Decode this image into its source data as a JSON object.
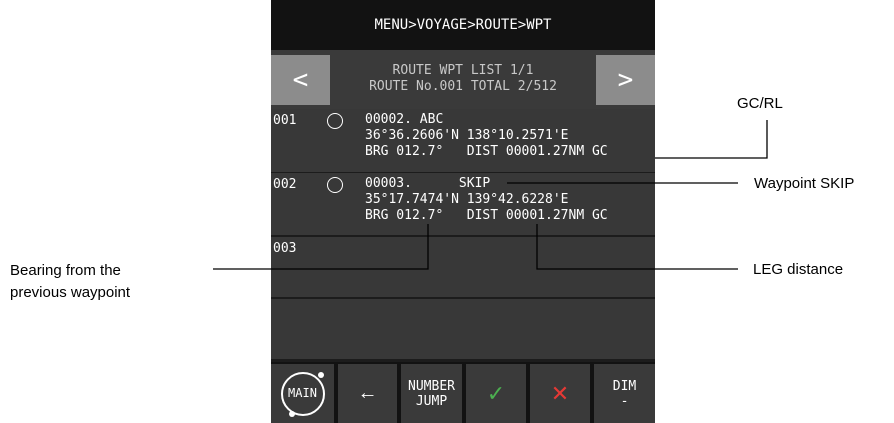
{
  "breadcrumb": "MENU>VOYAGE>ROUTE>WPT",
  "header": {
    "prev_label": "<",
    "next_label": ">",
    "title_line1": "ROUTE WPT LIST 1/1",
    "title_line2": "ROUTE No.001 TOTAL 2/512"
  },
  "waypoints": [
    {
      "no": "001",
      "line1": "00002. ABC",
      "line2": "36°36.2606'N 138°10.2571'E",
      "line3": "BRG 012.7°   DIST 00001.27NM GC"
    },
    {
      "no": "002",
      "line1": "00003.      SKIP",
      "line2": "35°17.7474'N 139°42.6228'E",
      "line3": "BRG 012.7°   DIST 00001.27NM GC"
    },
    {
      "no": "003"
    }
  ],
  "footer": {
    "main": "MAIN",
    "back": "←",
    "number_jump_line1": "NUMBER",
    "number_jump_line2": "JUMP",
    "ok": "✓",
    "cancel": "✕",
    "dim_line1": "DIM",
    "dim_line2": "-"
  },
  "callouts": {
    "gcrl": "GC/RL",
    "skip": "Waypoint SKIP",
    "bearing_line1": "Bearing from the",
    "bearing_line2": "previous waypoint",
    "leg": "LEG distance"
  },
  "colors": {
    "screen_bg": "#1c1c1c",
    "row_bg": "#383838",
    "nav_button": "#8c8c8c",
    "ok_green": "#4caf50",
    "cancel_red": "#e53935"
  }
}
